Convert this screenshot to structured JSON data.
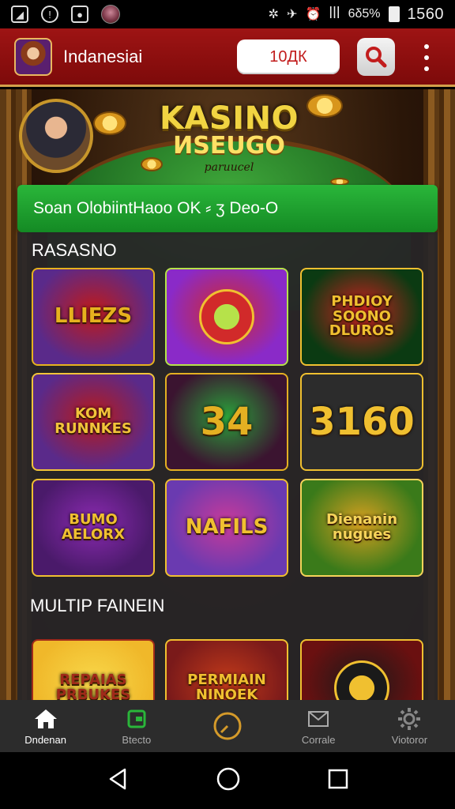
{
  "status_bar": {
    "time": "1560",
    "right_glyphs": [
      "✲",
      "✈",
      "⏰",
      "ꟾꟾꟾ",
      "6δ5%"
    ],
    "left_icons": [
      "image-icon",
      "shield-icon",
      "chat-icon",
      "avatar"
    ]
  },
  "app_bar": {
    "title": "Indanesiai",
    "balance": "10ДК"
  },
  "hero": {
    "title_line1": "KASINO",
    "title_line2": "ИSEUGO",
    "subtitle": "paruucel"
  },
  "banner": {
    "text": "Soan OlobiintHaoo OK  ⸗  ʒ  Deo-O"
  },
  "sections": [
    {
      "title": "RASASNO",
      "tiles": [
        {
          "label": "LLIEZS",
          "colors": [
            "#5a2a8a",
            "#c01a1a",
            "#e6b21e"
          ]
        },
        {
          "label": "",
          "colors": [
            "#8a2ac8",
            "#d12a2a",
            "#b6e24a"
          ]
        },
        {
          "label": "PHDIOY SOONO DLUROS",
          "colors": [
            "#0b3a12",
            "#d12020",
            "#f0c030"
          ]
        },
        {
          "label": "KOM RUNNKES",
          "colors": [
            "#5a2a8a",
            "#b81a1a",
            "#f2c43a"
          ]
        },
        {
          "label": "34",
          "colors": [
            "#3b1430",
            "#2aa23a",
            "#e4b022"
          ]
        },
        {
          "label": "3160",
          "colors": [
            "#2c2c2c",
            "#2c2c2c",
            "#f0c030"
          ]
        },
        {
          "label": "BUMO AELORX",
          "colors": [
            "#4a1a6a",
            "#8a2ab0",
            "#f0c030"
          ]
        },
        {
          "label": "NAFILS",
          "colors": [
            "#6a3ab0",
            "#c83a9a",
            "#f0c030"
          ]
        },
        {
          "label": "Dienanin nugues",
          "colors": [
            "#3a7a1a",
            "#d8a020",
            "#f6d45a"
          ]
        }
      ]
    },
    {
      "title": "MULTIP FAINEIN",
      "tiles": [
        {
          "label": "REPAIAS PRBUKES",
          "colors": [
            "#f0b82a",
            "#f8d84a",
            "#a02a1a"
          ]
        },
        {
          "label": "PERMIAIN NINOEK",
          "colors": [
            "#7a1a1a",
            "#c23a1a",
            "#f0c030"
          ]
        },
        {
          "label": "",
          "colors": [
            "#6a1010",
            "#1a1a1a",
            "#f0c030"
          ]
        }
      ]
    }
  ],
  "bottom_nav": [
    {
      "label": "Dndenan",
      "icon": "home-icon",
      "active": true
    },
    {
      "label": "Btecto",
      "icon": "wallet-icon",
      "active": false
    },
    {
      "label": "",
      "icon": "clock-icon",
      "active": false
    },
    {
      "label": "Corrale",
      "icon": "mail-icon",
      "active": false
    },
    {
      "label": "Viotoror",
      "icon": "gear-icon",
      "active": false
    }
  ],
  "system_nav": [
    "back-icon",
    "home-circle-icon",
    "recents-icon"
  ]
}
